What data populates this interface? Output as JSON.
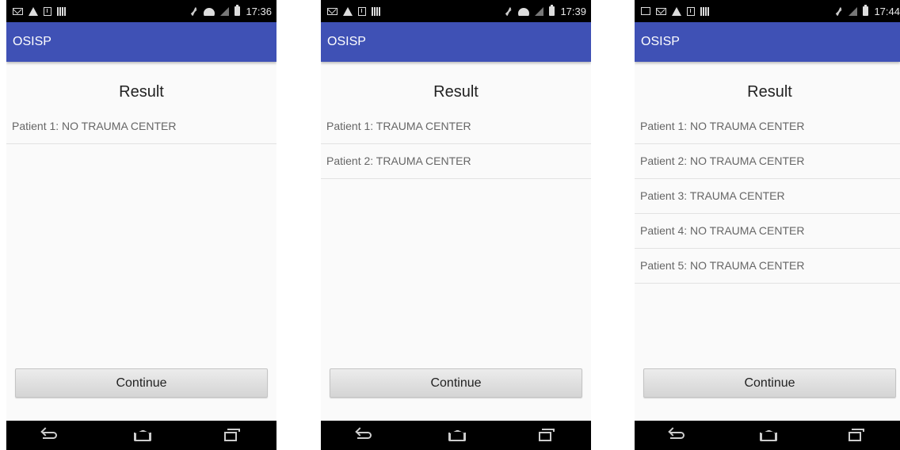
{
  "screens": [
    {
      "status_time": "17:36",
      "app_title": "OSISP",
      "heading": "Result",
      "patients": [
        "Patient 1: NO TRAUMA CENTER"
      ],
      "continue_label": "Continue"
    },
    {
      "status_time": "17:39",
      "app_title": "OSISP",
      "heading": "Result",
      "patients": [
        "Patient 1: TRAUMA CENTER",
        "Patient 2: TRAUMA CENTER"
      ],
      "continue_label": "Continue"
    },
    {
      "status_time": "17:44",
      "app_title": "OSISP",
      "heading": "Result",
      "patients": [
        "Patient 1: NO TRAUMA CENTER",
        "Patient 2: NO TRAUMA CENTER",
        "Patient 3: TRAUMA CENTER",
        "Patient 4: NO TRAUMA CENTER",
        "Patient 5: NO TRAUMA CENTER"
      ],
      "continue_label": "Continue"
    }
  ],
  "colors": {
    "appbar": "#3f51b5",
    "statusbar": "#000000",
    "background": "#fafafa"
  },
  "icons": [
    "mail-icon",
    "warning-icon",
    "download-icon",
    "barcode-icon",
    "mute-icon",
    "wifi-icon",
    "signal-icon",
    "battery-icon",
    "back-icon",
    "home-icon",
    "recent-apps-icon"
  ]
}
